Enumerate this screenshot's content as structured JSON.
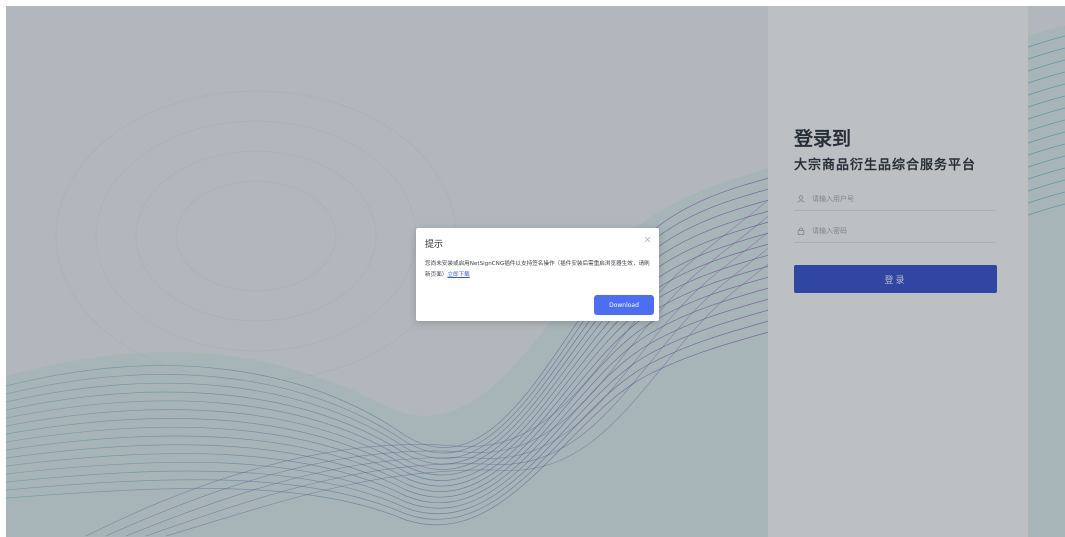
{
  "login": {
    "heading": "登录到",
    "subheading": "大宗商品衍生品综合服务平台",
    "username_placeholder": "请输入用户号",
    "password_placeholder": "请输入密码",
    "submit_label": "登录",
    "accent_color": "#2c47c9"
  },
  "dialog": {
    "title": "提示",
    "message": "您尚未安装或启用NetSignCNG插件以支持签名操作（插件安装后需重启浏览器生效，请刷新页面）",
    "link_text": "立即下载",
    "confirm_label": "Download",
    "close_icon": "close-icon"
  },
  "icons": {
    "username": "user-icon",
    "password": "lock-icon"
  }
}
